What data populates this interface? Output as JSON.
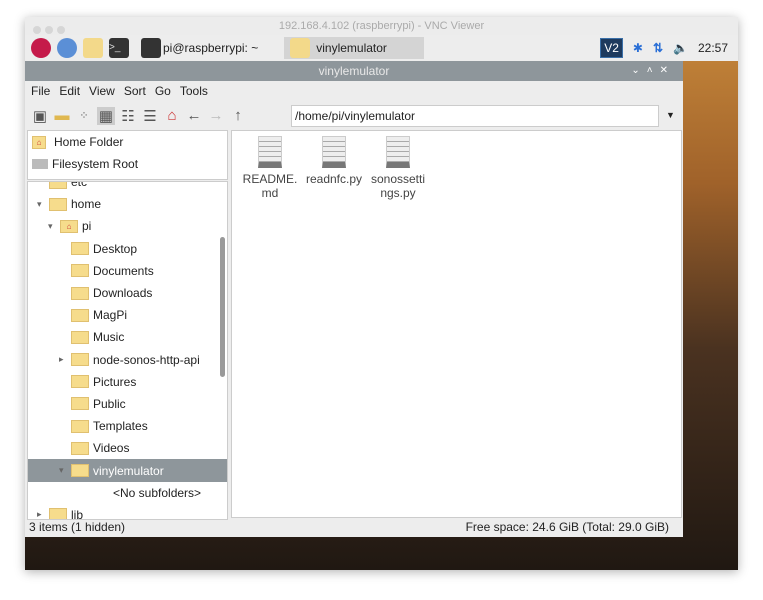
{
  "vnc": {
    "title": "192.168.4.102 (raspberrypi) - VNC Viewer"
  },
  "taskbar": {
    "terminal_task": "pi@raspberrypi: ~",
    "folder_task": "vinylemulator",
    "clock": "22:57"
  },
  "window": {
    "title": "vinylemulator"
  },
  "menu": [
    "File",
    "Edit",
    "View",
    "Sort",
    "Go",
    "Tools"
  ],
  "address": "/home/pi/vinylemulator",
  "places": [
    "Home Folder",
    "Filesystem Root"
  ],
  "tree": [
    {
      "label": "etc",
      "indent": 1
    },
    {
      "label": "home",
      "indent": 1,
      "exp": "▾"
    },
    {
      "label": "pi",
      "indent": 2,
      "exp": "▾",
      "home": true
    },
    {
      "label": "Desktop",
      "indent": 3
    },
    {
      "label": "Documents",
      "indent": 3
    },
    {
      "label": "Downloads",
      "indent": 3
    },
    {
      "label": "MagPi",
      "indent": 3
    },
    {
      "label": "Music",
      "indent": 3
    },
    {
      "label": "node-sonos-http-api",
      "indent": 3,
      "exp": "▸"
    },
    {
      "label": "Pictures",
      "indent": 3
    },
    {
      "label": "Public",
      "indent": 3
    },
    {
      "label": "Templates",
      "indent": 3
    },
    {
      "label": "Videos",
      "indent": 3
    },
    {
      "label": "vinylemulator",
      "indent": 3,
      "exp": "▾",
      "selected": true
    },
    {
      "label": "<No subfolders>",
      "indent": 4,
      "nofolder": true
    },
    {
      "label": "lib",
      "indent": 1,
      "exp": "▸"
    }
  ],
  "files": [
    "README.md",
    "readnfc.py",
    "sonossettings.py"
  ],
  "status": {
    "items": "3 items (1 hidden)",
    "free": "Free space: 24.6 GiB (Total: 29.0 GiB)"
  }
}
